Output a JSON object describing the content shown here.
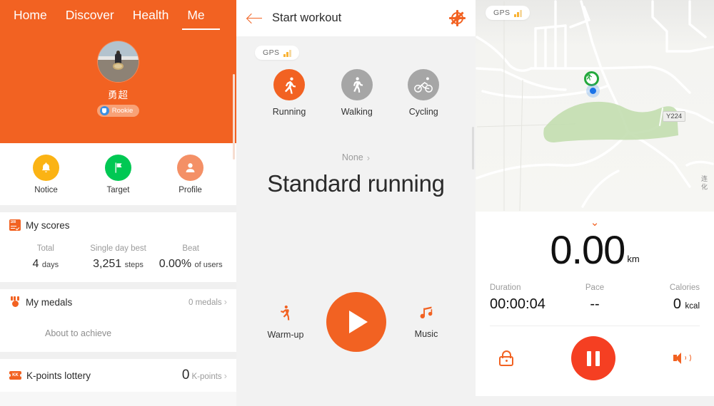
{
  "theme": {
    "orange": "#f26222",
    "red": "#f53f22",
    "green": "#00c853",
    "yellow": "#fbb314",
    "blue": "#1a73e8"
  },
  "profile_panel": {
    "tabs": [
      {
        "label": "Home",
        "active": false
      },
      {
        "label": "Discover",
        "active": false
      },
      {
        "label": "Health",
        "active": false
      },
      {
        "label": "Me",
        "active": true
      }
    ],
    "user": {
      "name": "勇超",
      "badge": "Rookie",
      "badge_icon": "shield-icon",
      "avatar": "user-photo"
    },
    "quick_actions": [
      {
        "label": "Notice",
        "icon": "bell-icon"
      },
      {
        "label": "Target",
        "icon": "flag-icon"
      },
      {
        "label": "Profile",
        "icon": "person-icon"
      }
    ],
    "scores": {
      "icon": "scores-100-icon",
      "title": "My scores",
      "items": [
        {
          "label": "Total",
          "value": "4",
          "unit": "days"
        },
        {
          "label": "Single day best",
          "value": "3,251",
          "unit": "steps"
        },
        {
          "label": "Beat",
          "value": "0.00%",
          "unit": "of users"
        }
      ]
    },
    "medals": {
      "icon": "medal-icon",
      "title": "My medals",
      "count": "0 medals",
      "chevron": "›",
      "placeholder": {
        "icon": "hexagon-locked-icon",
        "label": "About to achieve"
      }
    },
    "lottery": {
      "icon": "ticket-icon",
      "icon_text": "KK",
      "title": "K-points lottery",
      "value": "0",
      "unit": "K-points",
      "chevron": "›"
    }
  },
  "workout_panel": {
    "appbar": {
      "back_icon": "back-arrow-icon",
      "title": "Start workout",
      "settings_icon": "gear-icon"
    },
    "gps": {
      "label": "GPS",
      "icon": "signal-bars-icon"
    },
    "modes": [
      {
        "label": "Running",
        "icon": "running-icon",
        "selected": true
      },
      {
        "label": "Walking",
        "icon": "walking-icon",
        "selected": false
      },
      {
        "label": "Cycling",
        "icon": "cycling-icon",
        "selected": false
      }
    ],
    "goal": {
      "label": "None",
      "chevron": "›"
    },
    "mode_title": "Standard running",
    "warmup": {
      "label": "Warm-up",
      "icon": "stretching-person-icon"
    },
    "music": {
      "label": "Music",
      "icon": "music-note-icon"
    },
    "start": {
      "icon": "play-icon"
    }
  },
  "running_panel": {
    "gps": {
      "label": "GPS",
      "icon": "signal-bars-icon"
    },
    "map": {
      "road_labels": [
        "Y224"
      ],
      "cn_labels": [
        "连 化"
      ],
      "marker_icon": "running-marker-icon",
      "position_icon": "current-position-dot"
    },
    "collapse_chevron": "⌄",
    "distance": {
      "value": "0.00",
      "unit": "km"
    },
    "stats": [
      {
        "label": "Duration",
        "value": "00:00:04",
        "unit": ""
      },
      {
        "label": "Pace",
        "value": "--",
        "unit": ""
      },
      {
        "label": "Calories",
        "value": "0",
        "unit": "kcal"
      }
    ],
    "controls": {
      "lock": {
        "icon": "lock-icon"
      },
      "pause": {
        "icon": "pause-icon"
      },
      "sound": {
        "icon": "speaker-icon"
      }
    }
  }
}
